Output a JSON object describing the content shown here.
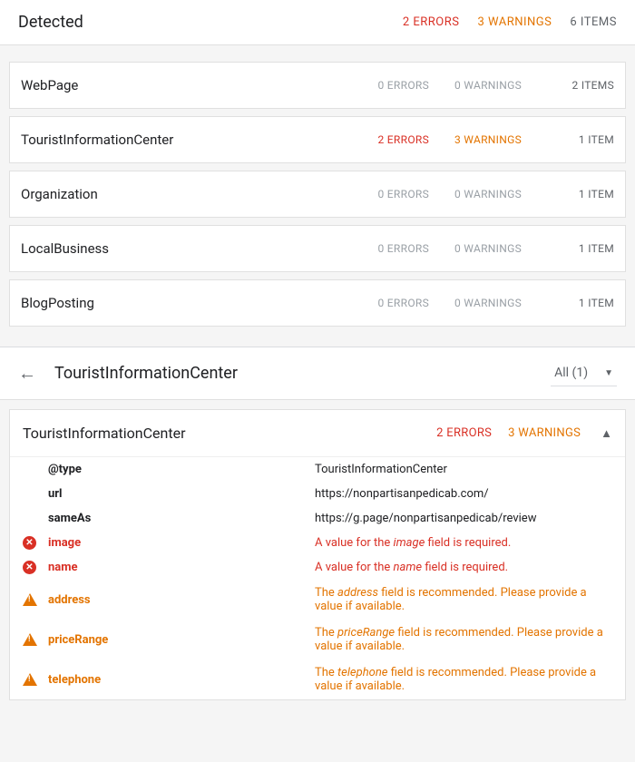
{
  "header": {
    "title": "Detected",
    "errors_label": "2 ERRORS",
    "warnings_label": "3 WARNINGS",
    "items_label": "6 ITEMS"
  },
  "cards": [
    {
      "title": "WebPage",
      "errors": "0 ERRORS",
      "warnings": "0 WARNINGS",
      "items": "2 ITEMS",
      "errors_zero": true,
      "warnings_zero": true
    },
    {
      "title": "TouristInformationCenter",
      "errors": "2 ERRORS",
      "warnings": "3 WARNINGS",
      "items": "1 ITEM",
      "errors_zero": false,
      "warnings_zero": false
    },
    {
      "title": "Organization",
      "errors": "0 ERRORS",
      "warnings": "0 WARNINGS",
      "items": "1 ITEM",
      "errors_zero": true,
      "warnings_zero": true
    },
    {
      "title": "LocalBusiness",
      "errors": "0 ERRORS",
      "warnings": "0 WARNINGS",
      "items": "1 ITEM",
      "errors_zero": true,
      "warnings_zero": true
    },
    {
      "title": "BlogPosting",
      "errors": "0 ERRORS",
      "warnings": "0 WARNINGS",
      "items": "1 ITEM",
      "errors_zero": true,
      "warnings_zero": true
    }
  ],
  "detail": {
    "title": "TouristInformationCenter",
    "filter_label": "All (1)",
    "card_title": "TouristInformationCenter",
    "card_errors": "2 ERRORS",
    "card_warnings": "3 WARNINGS",
    "properties": [
      {
        "kind": "normal",
        "name": "@type",
        "value": "TouristInformationCenter"
      },
      {
        "kind": "normal",
        "name": "url",
        "value": "https://nonpartisanpedicab.com/"
      },
      {
        "kind": "normal",
        "name": "sameAs",
        "value": "https://g.page/nonpartisanpedicab/review"
      },
      {
        "kind": "error",
        "name": "image",
        "value_pre": "A value for the ",
        "value_em": "image",
        "value_post": " field is required."
      },
      {
        "kind": "error",
        "name": "name",
        "value_pre": "A value for the ",
        "value_em": "name",
        "value_post": " field is required."
      },
      {
        "kind": "warning",
        "name": "address",
        "value_pre": "The ",
        "value_em": "address",
        "value_post": " field is recommended. Please provide a value if available."
      },
      {
        "kind": "warning",
        "name": "priceRange",
        "value_pre": "The ",
        "value_em": "priceRange",
        "value_post": " field is recommended. Please provide a value if available."
      },
      {
        "kind": "warning",
        "name": "telephone",
        "value_pre": "The ",
        "value_em": "telephone",
        "value_post": " field is recommended. Please provide a value if available."
      }
    ]
  }
}
